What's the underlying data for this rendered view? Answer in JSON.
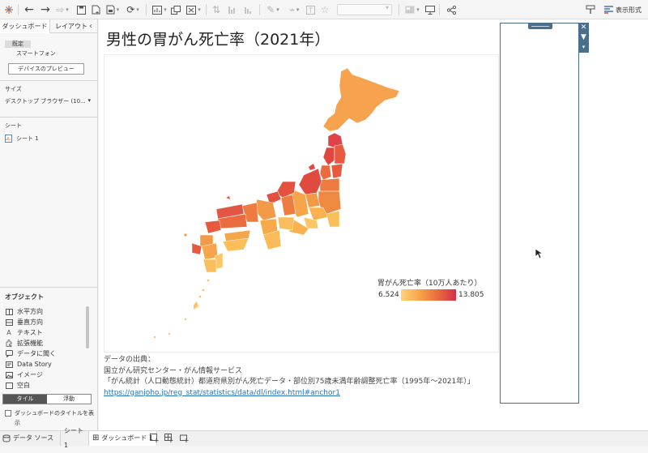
{
  "app": {
    "accent": "#e8762d",
    "panel_bg": "#f7f7f7",
    "selection": "#4a6f8c"
  },
  "toolbar": {
    "icons": [
      "tableau-logo-icon",
      "undo-icon",
      "redo-icon",
      "forward-icon",
      "save-icon",
      "new-datasource-icon",
      "pause-icon",
      "refresh-icon",
      "new-sheet-icon",
      "duplicate-icon",
      "clear-icon",
      "swap-icon",
      "sort-asc-icon",
      "sort-desc-icon",
      "highlight-icon",
      "group-icon",
      "label-icon",
      "pin-icon",
      "fit-dropdown",
      "show-cards-icon",
      "presentation-icon",
      "share-icon",
      "show-me-icon"
    ],
    "format_label": "表示形式"
  },
  "left_panel": {
    "tabs": [
      "ダッシュボード",
      "レイアウト"
    ],
    "device_default": "既定",
    "device_phone": "スマートフォン",
    "preview_button": "デバイスのプレビュー",
    "size_title": "サイズ",
    "size_value": "デスクトップ ブラウザー (10...",
    "sheets_title": "シート",
    "sheets": [
      "シート 1"
    ],
    "objects_title": "オブジェクト",
    "objects": [
      {
        "label": "水平方向",
        "icon": "horizontal-container-icon"
      },
      {
        "label": "垂直方向",
        "icon": "vertical-container-icon"
      },
      {
        "label": "テキスト",
        "icon": "text-icon"
      },
      {
        "label": "拡張機能",
        "icon": "extension-icon"
      },
      {
        "label": "データに聞く",
        "icon": "ask-data-icon"
      },
      {
        "label": "Data Story",
        "icon": "data-story-icon"
      },
      {
        "label": "イメージ",
        "icon": "image-icon"
      },
      {
        "label": "空白",
        "icon": "blank-icon"
      }
    ],
    "tile_label": "タイル",
    "float_label": "浮動",
    "show_title_label": "ダッシュボードのタイトルを表示"
  },
  "dashboard": {
    "title": "男性の胃がん死亡率（2021年）",
    "legend": {
      "title": "胃がん死亡率（10万人あたり）",
      "min": "6.524",
      "max": "13.805",
      "color_low": "#ffd37a",
      "color_high": "#d62f49"
    },
    "source_lines": [
      "データの出典：",
      "国立がん研究センター・がん情報サービス",
      "「がん統計（人口動態統計）都道府県別がん死亡データ・部位別75歳未満年齢調整死亡率（1995年～2021年）」"
    ],
    "source_link": "https://ganjoho.jp/reg_stat/statistics/data/dl/index.html#anchor1"
  },
  "bottom_tabs": {
    "data_source": "データ ソース",
    "sheet": "シート 1",
    "dashboard": "ダッシュボード 1"
  }
}
